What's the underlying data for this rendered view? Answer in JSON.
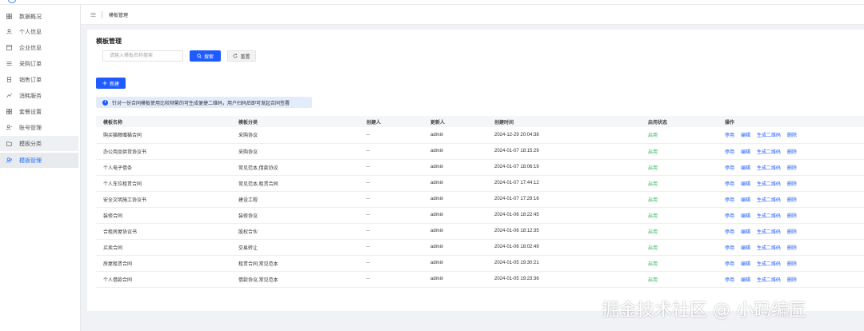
{
  "sidebar": {
    "items": [
      {
        "label": "数据概况",
        "icon": "grid-icon",
        "active": false
      },
      {
        "label": "个人信息",
        "icon": "user-icon",
        "active": false
      },
      {
        "label": "企业信息",
        "icon": "building-icon",
        "active": false
      },
      {
        "label": "采购订单",
        "icon": "list-icon",
        "active": false
      },
      {
        "label": "销售订单",
        "icon": "receipt-icon",
        "active": false
      },
      {
        "label": "消耗服务",
        "icon": "usage-icon",
        "active": false
      },
      {
        "label": "套餐设置",
        "icon": "package-icon",
        "active": false
      },
      {
        "label": "账号管理",
        "icon": "account-icon",
        "active": false
      },
      {
        "label": "模板分类",
        "icon": "folder-icon",
        "active": false
      },
      {
        "label": "模板管理",
        "icon": "template-icon",
        "active": true
      }
    ]
  },
  "breadcrumb": {
    "current": "模板管理"
  },
  "page": {
    "title": "模板管理",
    "search_placeholder": "请输入模板名称搜索",
    "search_label": "搜索",
    "reset_label": "重置",
    "new_label": "新建",
    "notice": "针对一份合同模板使用比较频繁的可生成便捷二维码，用户扫码后即可发起合同签署"
  },
  "table": {
    "columns": [
      "模板名称",
      "模板分类",
      "创建人",
      "更新人",
      "创建时间",
      "启用状态",
      "操作"
    ],
    "ops": [
      "停用",
      "编辑",
      "生成二维码",
      "删除"
    ],
    "rows": [
      {
        "name": "购买猫粮赠猫合同",
        "category": "采购协议",
        "creator": "--",
        "updater": "admin",
        "created": "2024-12-29 20:04:38",
        "status": "启用"
      },
      {
        "name": "办公用品供货协议书",
        "category": "采购协议",
        "creator": "--",
        "updater": "admin",
        "created": "2024-01-07 18:15:29",
        "status": "启用"
      },
      {
        "name": "个人电子借条",
        "category": "常见范本,借款协议",
        "creator": "--",
        "updater": "admin",
        "created": "2024-01-07 18:06:19",
        "status": "启用"
      },
      {
        "name": "个人车位租赁合同",
        "category": "常见范本,租赁合同",
        "creator": "--",
        "updater": "admin",
        "created": "2024-01-07 17:44:12",
        "status": "启用"
      },
      {
        "name": "安全文明施工协议书",
        "category": "建设工程",
        "creator": "--",
        "updater": "admin",
        "created": "2024-01-07 17:29:16",
        "status": "启用"
      },
      {
        "name": "装修合同",
        "category": "装修协议",
        "creator": "--",
        "updater": "admin",
        "created": "2024-01-06 18:22:45",
        "status": "启用"
      },
      {
        "name": "合租房屋协议书",
        "category": "股权合伙",
        "creator": "--",
        "updater": "admin",
        "created": "2024-01-06 18:12:35",
        "status": "启用"
      },
      {
        "name": "买卖合同",
        "category": "交易转让",
        "creator": "--",
        "updater": "admin",
        "created": "2024-01-06 18:02:49",
        "status": "启用"
      },
      {
        "name": "房屋租赁合同",
        "category": "租赁合同,常见范本",
        "creator": "--",
        "updater": "admin",
        "created": "2024-01-05 19:30:21",
        "status": "启用"
      },
      {
        "name": "个人借款合同",
        "category": "借款协议,常见范本",
        "creator": "--",
        "updater": "admin",
        "created": "2024-01-05 19:23:36",
        "status": "启用"
      }
    ]
  },
  "watermark": "掘金技术社区 @ 小码编匠",
  "colors": {
    "primary": "#1f5bff",
    "success": "#2db84d",
    "notice_bg": "#e3ecfb"
  }
}
